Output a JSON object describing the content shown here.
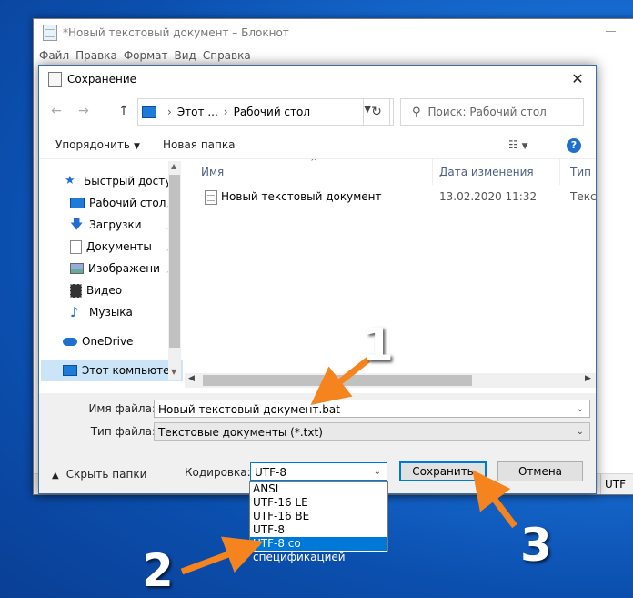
{
  "notepad": {
    "title": "*Новый текстовый документ – Блокнот",
    "menu": [
      "Файл",
      "Правка",
      "Формат",
      "Вид",
      "Справка"
    ],
    "status_encoding": "UTF"
  },
  "dialog": {
    "title": "Сохранение",
    "close_glyph": "✕",
    "nav": {
      "back": "←",
      "forward": "→",
      "up": "↑",
      "refresh": "↻"
    },
    "address": {
      "segment1": "Этот ...",
      "segment2": "Рабочий стол",
      "sep": "›"
    },
    "search": {
      "placeholder": "Поиск: Рабочий стол"
    },
    "toolbar": {
      "organize": "Упорядочить",
      "new_folder": "Новая папка",
      "view_glyph": "☷",
      "help": "?"
    },
    "nav_items": [
      {
        "label": "Быстрый доступ",
        "icon": "star-icon",
        "pinned": false
      },
      {
        "label": "Рабочий стол",
        "icon": "desktop-icon",
        "pinned": true
      },
      {
        "label": "Загрузки",
        "icon": "download-icon",
        "pinned": true
      },
      {
        "label": "Документы",
        "icon": "documents-icon",
        "pinned": true
      },
      {
        "label": "Изображени",
        "icon": "pictures-icon",
        "pinned": true
      },
      {
        "label": "Видео",
        "icon": "video-icon",
        "pinned": false
      },
      {
        "label": "Музыка",
        "icon": "music-icon",
        "pinned": false
      },
      {
        "label": "OneDrive",
        "icon": "cloud-icon",
        "pinned": false
      },
      {
        "label": "Этот компьютер",
        "icon": "computer-icon",
        "pinned": false
      }
    ],
    "columns": {
      "name": "Имя",
      "modified": "Дата изменения",
      "type": "Тип"
    },
    "files": [
      {
        "name": "Новый текстовый документ",
        "modified": "13.02.2020 11:32",
        "type": "Текст"
      }
    ],
    "filename_label": "Имя файла:",
    "filename_value": "Новый текстовый документ.bat",
    "filetype_label": "Тип файла:",
    "filetype_value": "Текстовые документы (*.txt)",
    "hide_folders": "Скрыть папки",
    "encoding_label": "Кодировка:",
    "encoding_value": "UTF-8",
    "encoding_options": [
      "ANSI",
      "UTF-16 LE",
      "UTF-16 BE",
      "UTF-8",
      "UTF-8 со спецификацией"
    ],
    "encoding_highlighted": "UTF-8 со спецификацией",
    "save_button": "Сохранить",
    "cancel_button": "Отмена"
  },
  "annotations": {
    "step1": "1",
    "step2": "2",
    "step3": "3",
    "arrow_color": "#f5841f"
  }
}
